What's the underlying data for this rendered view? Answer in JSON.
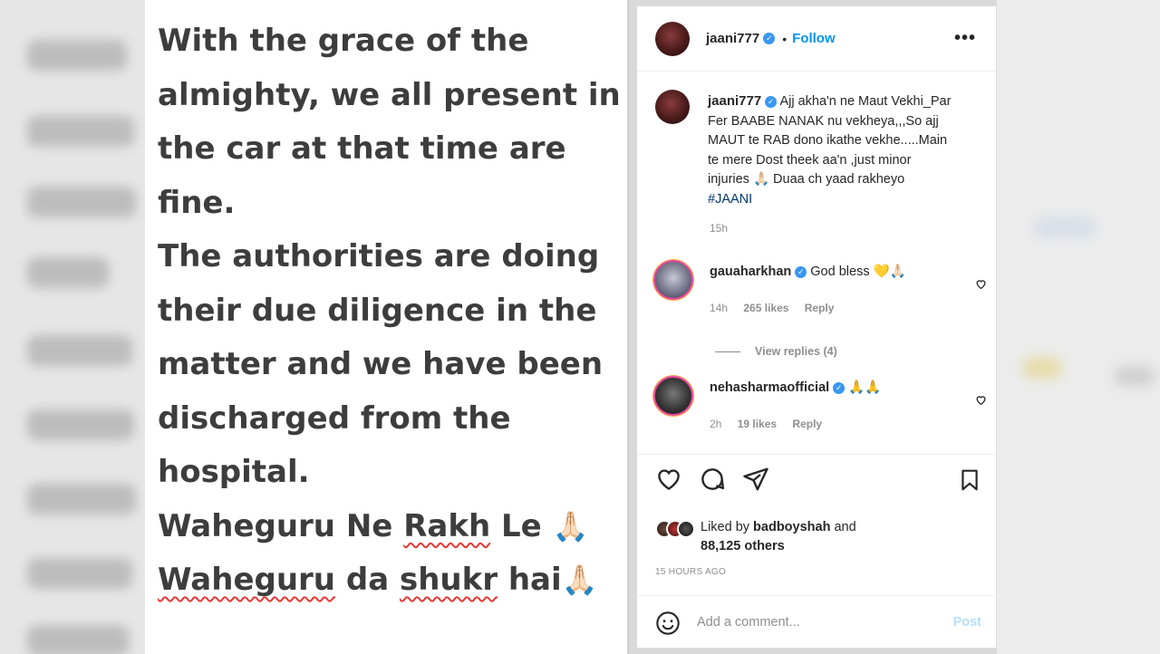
{
  "post_image": {
    "lines": [
      "With the grace of the",
      "almighty, we all present in",
      "the car at that time are",
      "fine.",
      "The authorities are doing",
      "their due diligence in the",
      "matter and we have been",
      "discharged from the",
      "hospital."
    ],
    "line10": {
      "a": "Waheguru Ne ",
      "b": "Rakh",
      "c": " Le ",
      "emoji": "🙏🏻"
    },
    "line11": {
      "a": "Waheguru",
      "b": " da ",
      "c": "shukr",
      "d": " hai",
      "emoji": "🙏🏻"
    }
  },
  "header": {
    "username": "jaani777",
    "verified": "✓",
    "separator": "•",
    "follow_label": "Follow",
    "more_label": "•••"
  },
  "caption": {
    "username": "jaani777",
    "text": "Ajj akha'n ne Maut Vekhi_Par Fer BAABE NANAK nu vekheya,,,So ajj MAUT te RAB dono ikathe vekhe.....Main te mere Dost theek aa'n ,just minor injuries 🙏🏻 Duaa ch yaad rakheyo ",
    "hashtag": "#JAANI",
    "time": "15h"
  },
  "comments": [
    {
      "username": "gauaharkhan",
      "text": "God bless 💛🙏🏻",
      "time": "14h",
      "likes": "265 likes",
      "reply": "Reply"
    },
    {
      "username": "nehasharmaofficial",
      "text": "🙏🙏",
      "time": "2h",
      "likes": "19 likes",
      "reply": "Reply"
    }
  ],
  "view_replies": "View replies (4)",
  "likes": {
    "prefix": "Liked by ",
    "user": "badboyshah",
    "middle": " and",
    "count": "88,125 others"
  },
  "posted_time": "15 HOURS AGO",
  "add_comment": {
    "placeholder": "Add a comment...",
    "post_label": "Post"
  },
  "colors": {
    "link_blue": "#0095f6",
    "verified_blue": "#3897f0",
    "meta_gray": "#8e8e8e",
    "spell_red": "#e53935"
  }
}
